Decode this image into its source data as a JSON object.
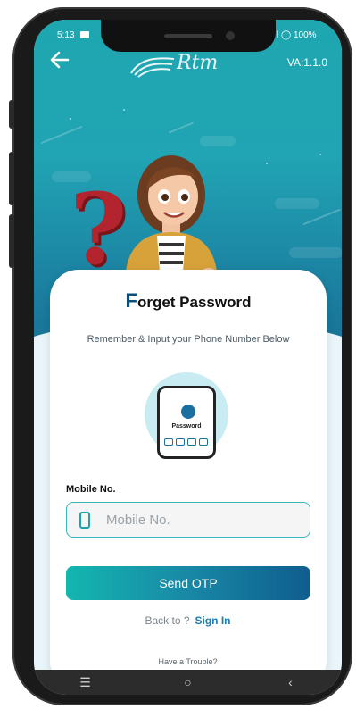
{
  "status_bar": {
    "time": "5:13",
    "right": "l ◯ 100%"
  },
  "app_bar": {
    "back_icon": "arrow-left-icon",
    "logo_text": "Rtm",
    "version": "VA:1.1.0"
  },
  "illustration": {
    "question_mark": "?"
  },
  "card": {
    "title_first_letter": "F",
    "title_rest": "orget Password",
    "subtitle": "Remember & Input your Phone Number Below",
    "phone_label": "Password"
  },
  "form": {
    "mobile_label": "Mobile No.",
    "mobile_placeholder": "Mobile No.",
    "mobile_value": "",
    "send_button": "Send OTP"
  },
  "links": {
    "back_to": "Back to ?",
    "sign_in": "Sign In",
    "trouble": "Have a Trouble?"
  },
  "nav_bar": {
    "recent": "☰",
    "home": "○",
    "back": "‹"
  },
  "colors": {
    "accent_teal": "#1ea7b0",
    "accent_blue": "#0f5d8e",
    "link": "#1b7bb5"
  }
}
